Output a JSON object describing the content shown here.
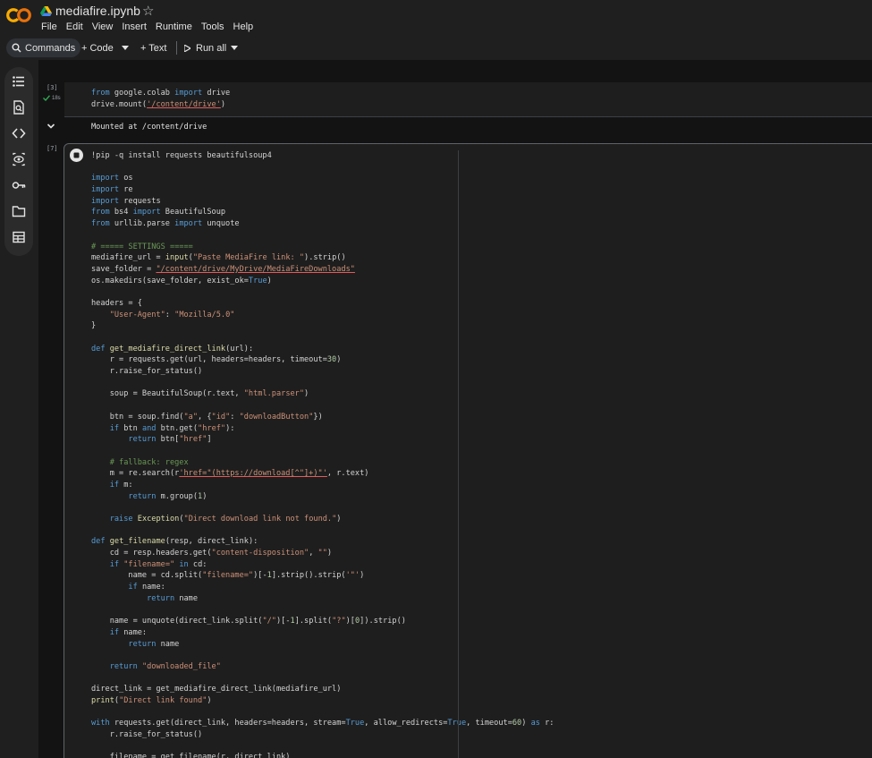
{
  "header": {
    "title": "mediafire.ipynb",
    "logo_text": "CO",
    "menu": [
      "File",
      "Edit",
      "View",
      "Insert",
      "Runtime",
      "Tools",
      "Help"
    ]
  },
  "toolbar": {
    "commands": "Commands",
    "code": "+ Code",
    "text": "+ Text",
    "run_all": "Run all"
  },
  "cell1": {
    "number": "[3]",
    "time": "18s",
    "lines": [
      [
        [
          "from",
          "kw"
        ],
        [
          " google.colab ",
          ""
        ],
        [
          "import",
          "kw"
        ],
        [
          " drive",
          ""
        ]
      ],
      [
        [
          "drive.mount(",
          ""
        ],
        [
          "'/content/drive'",
          "str ul"
        ],
        [
          ")",
          ""
        ]
      ]
    ],
    "output": "Mounted at /content/drive"
  },
  "cell2": {
    "number": "[7]",
    "lines": [
      [
        [
          "!pip -q install requests beautifulsoup4",
          ""
        ]
      ],
      [],
      [
        [
          "import",
          "kw"
        ],
        [
          " os",
          ""
        ]
      ],
      [
        [
          "import",
          "kw"
        ],
        [
          " re",
          ""
        ]
      ],
      [
        [
          "import",
          "kw"
        ],
        [
          " requests",
          ""
        ]
      ],
      [
        [
          "from",
          "kw"
        ],
        [
          " bs4 ",
          ""
        ],
        [
          "import",
          "kw"
        ],
        [
          " BeautifulSoup",
          ""
        ]
      ],
      [
        [
          "from",
          "kw"
        ],
        [
          " urllib.parse ",
          ""
        ],
        [
          "import",
          "kw"
        ],
        [
          " unquote",
          ""
        ]
      ],
      [],
      [
        [
          "# ===== SETTINGS =====",
          "com"
        ]
      ],
      [
        [
          "mediafire_url = ",
          ""
        ],
        [
          "input",
          "fn"
        ],
        [
          "(",
          ""
        ],
        [
          "\"Paste MediaFire link: \"",
          "str"
        ],
        [
          ").strip()",
          ""
        ]
      ],
      [
        [
          "save_folder = ",
          ""
        ],
        [
          "\"/content/drive/MyDrive/MediaFireDownloads\"",
          "str ul"
        ]
      ],
      [
        [
          "os.makedirs(save_folder, exist_ok=",
          ""
        ],
        [
          "True",
          "kw"
        ],
        [
          ")",
          ""
        ]
      ],
      [],
      [
        [
          "headers = {",
          ""
        ]
      ],
      [
        [
          "    ",
          ""
        ],
        [
          "\"User-Agent\"",
          "str"
        ],
        [
          ": ",
          ""
        ],
        [
          "\"Mozilla/5.0\"",
          "str"
        ]
      ],
      [
        [
          "}",
          ""
        ]
      ],
      [],
      [
        [
          "def",
          "kw"
        ],
        [
          " ",
          ""
        ],
        [
          "get_mediafire_direct_link",
          "fn"
        ],
        [
          "(url):",
          ""
        ]
      ],
      [
        [
          "    r = requests.get(url, headers=headers, timeout=",
          ""
        ],
        [
          "30",
          "num"
        ],
        [
          ")",
          ""
        ]
      ],
      [
        [
          "    r.raise_for_status()",
          ""
        ]
      ],
      [],
      [
        [
          "    soup = BeautifulSoup(r.text, ",
          ""
        ],
        [
          "\"html.parser\"",
          "str"
        ],
        [
          ")",
          ""
        ]
      ],
      [],
      [
        [
          "    btn = soup.find(",
          ""
        ],
        [
          "\"a\"",
          "str"
        ],
        [
          ", {",
          ""
        ],
        [
          "\"id\"",
          "str"
        ],
        [
          ": ",
          ""
        ],
        [
          "\"downloadButton\"",
          "str"
        ],
        [
          "})",
          ""
        ]
      ],
      [
        [
          "    ",
          ""
        ],
        [
          "if",
          "kw"
        ],
        [
          " btn ",
          ""
        ],
        [
          "and",
          "kw"
        ],
        [
          " btn.get(",
          ""
        ],
        [
          "\"href\"",
          "str"
        ],
        [
          "):",
          ""
        ]
      ],
      [
        [
          "        ",
          ""
        ],
        [
          "return",
          "kw"
        ],
        [
          " btn[",
          ""
        ],
        [
          "\"href\"",
          "str"
        ],
        [
          "]",
          ""
        ]
      ],
      [],
      [
        [
          "    # fallback: regex",
          "com"
        ]
      ],
      [
        [
          "    m = re.search(r",
          ""
        ],
        [
          "'href=\"(https://download[^\"]+)\"'",
          "str ul"
        ],
        [
          ", r.text)",
          ""
        ]
      ],
      [
        [
          "    ",
          ""
        ],
        [
          "if",
          "kw"
        ],
        [
          " m:",
          ""
        ]
      ],
      [
        [
          "        ",
          ""
        ],
        [
          "return",
          "kw"
        ],
        [
          " m.group(",
          ""
        ],
        [
          "1",
          "num"
        ],
        [
          ")",
          ""
        ]
      ],
      [],
      [
        [
          "    ",
          ""
        ],
        [
          "raise",
          "kw"
        ],
        [
          " ",
          ""
        ],
        [
          "Exception",
          "fn"
        ],
        [
          "(",
          ""
        ],
        [
          "\"Direct download link not found.\"",
          "str"
        ],
        [
          ")",
          ""
        ]
      ],
      [],
      [
        [
          "def",
          "kw"
        ],
        [
          " ",
          ""
        ],
        [
          "get_filename",
          "fn"
        ],
        [
          "(resp, direct_link):",
          ""
        ]
      ],
      [
        [
          "    cd = resp.headers.get(",
          ""
        ],
        [
          "\"content-disposition\"",
          "str"
        ],
        [
          ", ",
          ""
        ],
        [
          "\"\"",
          "str"
        ],
        [
          ")",
          ""
        ]
      ],
      [
        [
          "    ",
          ""
        ],
        [
          "if",
          "kw"
        ],
        [
          " ",
          ""
        ],
        [
          "\"filename=\"",
          "str"
        ],
        [
          " ",
          ""
        ],
        [
          "in",
          "kw"
        ],
        [
          " cd:",
          ""
        ]
      ],
      [
        [
          "        name = cd.split(",
          ""
        ],
        [
          "\"filename=\"",
          "str"
        ],
        [
          ")[-",
          ""
        ],
        [
          "1",
          "num"
        ],
        [
          "].strip().strip(",
          ""
        ],
        [
          "'\"'",
          "str"
        ],
        [
          ")",
          ""
        ]
      ],
      [
        [
          "        ",
          ""
        ],
        [
          "if",
          "kw"
        ],
        [
          " name:",
          ""
        ]
      ],
      [
        [
          "            ",
          ""
        ],
        [
          "return",
          "kw"
        ],
        [
          " name",
          ""
        ]
      ],
      [],
      [
        [
          "    name = unquote(direct_link.split(",
          ""
        ],
        [
          "\"/\"",
          "str"
        ],
        [
          ")[-",
          ""
        ],
        [
          "1",
          "num"
        ],
        [
          "].split(",
          ""
        ],
        [
          "\"?\"",
          "str"
        ],
        [
          ")[",
          ""
        ],
        [
          "0",
          "num"
        ],
        [
          "]).strip()",
          ""
        ]
      ],
      [
        [
          "    ",
          ""
        ],
        [
          "if",
          "kw"
        ],
        [
          " name:",
          ""
        ]
      ],
      [
        [
          "        ",
          ""
        ],
        [
          "return",
          "kw"
        ],
        [
          " name",
          ""
        ]
      ],
      [],
      [
        [
          "    ",
          ""
        ],
        [
          "return",
          "kw"
        ],
        [
          " ",
          ""
        ],
        [
          "\"downloaded_file\"",
          "str"
        ]
      ],
      [],
      [
        [
          "direct_link = get_mediafire_direct_link(mediafire_url)",
          ""
        ]
      ],
      [
        [
          "print",
          "fn"
        ],
        [
          "(",
          ""
        ],
        [
          "\"Direct link found\"",
          "str"
        ],
        [
          ")",
          ""
        ]
      ],
      [],
      [
        [
          "with",
          "kw"
        ],
        [
          " requests.get(direct_link, headers=headers, stream=",
          ""
        ],
        [
          "True",
          "kw"
        ],
        [
          ", allow_redirects=",
          ""
        ],
        [
          "True",
          "kw"
        ],
        [
          ", timeout=",
          ""
        ],
        [
          "60",
          "num"
        ],
        [
          ") ",
          ""
        ],
        [
          "as",
          "kw"
        ],
        [
          " r:",
          ""
        ]
      ],
      [
        [
          "    r.raise_for_status()",
          ""
        ]
      ],
      [],
      [
        [
          "    filename = get_filename(r, direct_link)",
          ""
        ]
      ]
    ]
  }
}
